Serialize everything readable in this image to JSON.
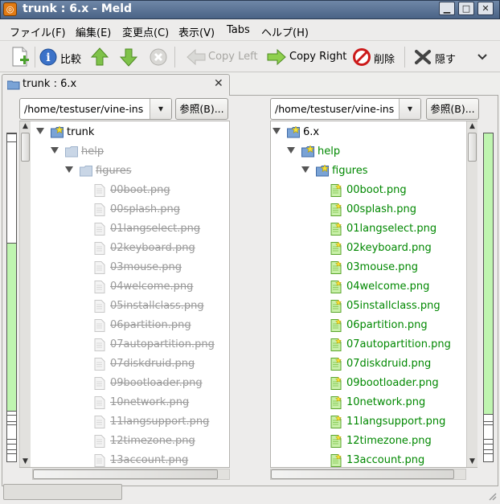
{
  "window": {
    "title": "trunk : 6.x - Meld",
    "app_icon": "meld-icon",
    "controls": [
      "minimize-icon",
      "maximize-icon",
      "close-icon"
    ]
  },
  "menubar": {
    "items": [
      "ファイル(F)",
      "編集(E)",
      "変更点(C)",
      "表示(V)",
      "Tabs",
      "ヘルプ(H)"
    ]
  },
  "toolbar": {
    "new_icon": "new-comparison-icon",
    "compare_label": "比較",
    "compare_icon": "info-icon",
    "prev_icon": "go-up-icon",
    "next_icon": "go-down-icon",
    "stop_icon": "stop-icon",
    "copy_left_label": "Copy Left",
    "copy_right_label": "Copy Right",
    "delete_label": "削除",
    "hide_label": "隠す",
    "overflow_icon": "chevron-down-icon"
  },
  "tab": {
    "label": "trunk : 6.x",
    "close": "✕"
  },
  "left": {
    "path": "/home/testuser/vine-ins",
    "browse_label": "参照(B)...",
    "rows": [
      {
        "label": "trunk",
        "kind": "folder",
        "level": 0,
        "state": "normal"
      },
      {
        "label": "help",
        "kind": "folder",
        "level": 1,
        "state": "missing"
      },
      {
        "label": "figures",
        "kind": "folder",
        "level": 2,
        "state": "missing"
      },
      {
        "label": "00boot.png",
        "kind": "file",
        "level": 3,
        "state": "missing"
      },
      {
        "label": "00splash.png",
        "kind": "file",
        "level": 3,
        "state": "missing"
      },
      {
        "label": "01langselect.png",
        "kind": "file",
        "level": 3,
        "state": "missing"
      },
      {
        "label": "02keyboard.png",
        "kind": "file",
        "level": 3,
        "state": "missing"
      },
      {
        "label": "03mouse.png",
        "kind": "file",
        "level": 3,
        "state": "missing"
      },
      {
        "label": "04welcome.png",
        "kind": "file",
        "level": 3,
        "state": "missing"
      },
      {
        "label": "05installclass.png",
        "kind": "file",
        "level": 3,
        "state": "missing"
      },
      {
        "label": "06partition.png",
        "kind": "file",
        "level": 3,
        "state": "missing"
      },
      {
        "label": "07autopartition.png",
        "kind": "file",
        "level": 3,
        "state": "missing"
      },
      {
        "label": "07diskdruid.png",
        "kind": "file",
        "level": 3,
        "state": "missing"
      },
      {
        "label": "09bootloader.png",
        "kind": "file",
        "level": 3,
        "state": "missing"
      },
      {
        "label": "10network.png",
        "kind": "file",
        "level": 3,
        "state": "missing"
      },
      {
        "label": "11langsupport.png",
        "kind": "file",
        "level": 3,
        "state": "missing"
      },
      {
        "label": "12timezone.png",
        "kind": "file",
        "level": 3,
        "state": "missing"
      },
      {
        "label": "13account.png",
        "kind": "file",
        "level": 3,
        "state": "missing"
      }
    ]
  },
  "right": {
    "path": "/home/testuser/vine-ins",
    "browse_label": "参照(B)...",
    "rows": [
      {
        "label": "6.x",
        "kind": "folder",
        "level": 0,
        "state": "normal"
      },
      {
        "label": "help",
        "kind": "folder",
        "level": 1,
        "state": "new"
      },
      {
        "label": "figures",
        "kind": "folder",
        "level": 2,
        "state": "new"
      },
      {
        "label": "00boot.png",
        "kind": "file",
        "level": 3,
        "state": "new"
      },
      {
        "label": "00splash.png",
        "kind": "file",
        "level": 3,
        "state": "new"
      },
      {
        "label": "01langselect.png",
        "kind": "file",
        "level": 3,
        "state": "new"
      },
      {
        "label": "02keyboard.png",
        "kind": "file",
        "level": 3,
        "state": "new"
      },
      {
        "label": "03mouse.png",
        "kind": "file",
        "level": 3,
        "state": "new"
      },
      {
        "label": "04welcome.png",
        "kind": "file",
        "level": 3,
        "state": "new"
      },
      {
        "label": "05installclass.png",
        "kind": "file",
        "level": 3,
        "state": "new"
      },
      {
        "label": "06partition.png",
        "kind": "file",
        "level": 3,
        "state": "new"
      },
      {
        "label": "07autopartition.png",
        "kind": "file",
        "level": 3,
        "state": "new"
      },
      {
        "label": "07diskdruid.png",
        "kind": "file",
        "level": 3,
        "state": "new"
      },
      {
        "label": "09bootloader.png",
        "kind": "file",
        "level": 3,
        "state": "new"
      },
      {
        "label": "10network.png",
        "kind": "file",
        "level": 3,
        "state": "new"
      },
      {
        "label": "11langsupport.png",
        "kind": "file",
        "level": 3,
        "state": "new"
      },
      {
        "label": "12timezone.png",
        "kind": "file",
        "level": 3,
        "state": "new"
      },
      {
        "label": "13account.png",
        "kind": "file",
        "level": 3,
        "state": "new"
      }
    ]
  },
  "colors": {
    "new_text": "#008800",
    "missing_text": "#9a9a9a",
    "diffmap_green": "#bff5b0",
    "titlebar": "#5a7397"
  }
}
